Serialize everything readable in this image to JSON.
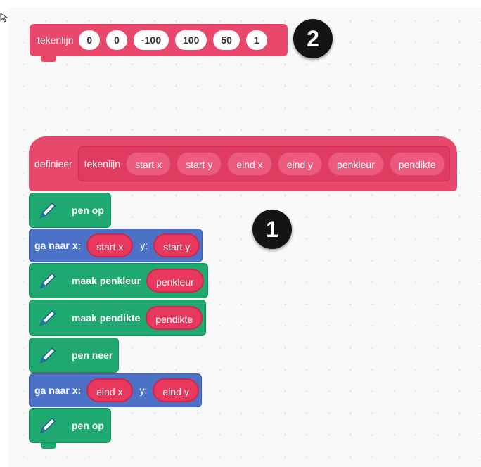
{
  "custom_block": {
    "name": "tekenlijn",
    "args": [
      "0",
      "0",
      "-100",
      "100",
      "50",
      "1"
    ]
  },
  "badges": {
    "call": "2",
    "definition": "1"
  },
  "definition": {
    "keyword": "definieer",
    "name": "tekenlijn",
    "params": [
      "start x",
      "start y",
      "eind x",
      "eind y",
      "penkleur",
      "pendikte"
    ]
  },
  "blocks": {
    "pen_up_1": "pen op",
    "goto_1": {
      "prefix": "ga naar x:",
      "x": "start x",
      "ylabel": "y:",
      "y": "start y"
    },
    "set_color": {
      "label": "maak penkleur",
      "value": "penkleur"
    },
    "set_size": {
      "label": "maak pendikte",
      "value": "pendikte"
    },
    "pen_down": "pen neer",
    "goto_2": {
      "prefix": "ga naar x:",
      "x": "eind x",
      "ylabel": "y:",
      "y": "eind y"
    },
    "pen_up_2": "pen op"
  },
  "colors": {
    "custom_block": "#e8486c",
    "pen_extension": "#1fa971",
    "motion": "#4c72c8",
    "badge": "#141414"
  },
  "icons": {
    "pen": "pen-icon",
    "cursor": "cursor-icon"
  }
}
